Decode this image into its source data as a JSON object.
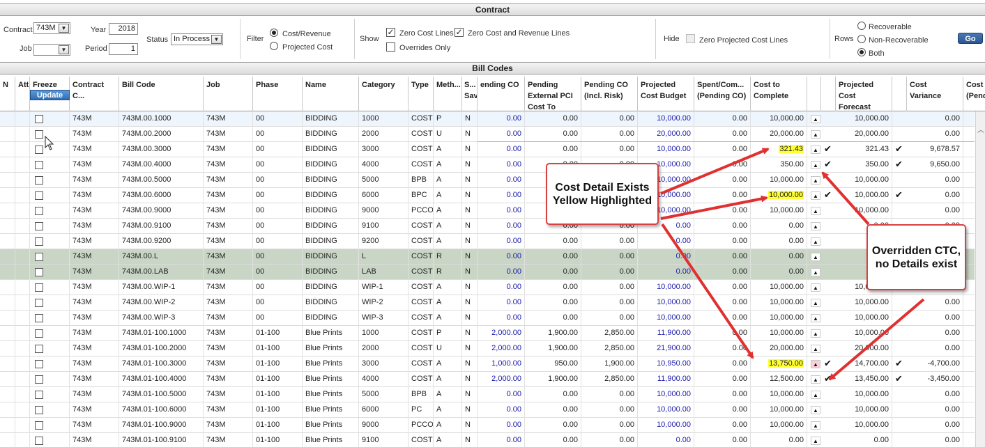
{
  "contract_section": {
    "title": "Contract",
    "contract_label": "Contract",
    "contract_value": "743M",
    "job_label": "Job",
    "job_value": "",
    "year_label": "Year",
    "year_value": "2018",
    "period_label": "Period",
    "period_value": "1",
    "status_label": "Status",
    "status_value": "In Process",
    "filter_label": "Filter",
    "filter_options": [
      "Cost/Revenue",
      "Projected Cost"
    ],
    "filter_selected": "Cost/Revenue",
    "show_label": "Show",
    "show_zero_cost_lines": "Zero Cost Lines",
    "show_zero_cost_revenue_lines": "Zero Cost and Revenue Lines",
    "show_overrides_only": "Overrides Only",
    "hide_label": "Hide",
    "hide_zero_projected": "Zero Projected Cost Lines",
    "rows_label": "Rows",
    "rows_options": [
      "Recoverable",
      "Non-Recoverable",
      "Both"
    ],
    "rows_selected": "Both",
    "go_label": "Go"
  },
  "bill_codes": {
    "title": "Bill Codes",
    "update_label": "Update",
    "headers": {
      "n": "N",
      "att": "Att",
      "freeze": "Freeze",
      "contract_c": "Contract C...",
      "bill_code": "Bill Code",
      "job": "Job",
      "phase": "Phase",
      "name": "Name",
      "category": "Category",
      "type": "Type",
      "meth": "Meth...",
      "s": "S...\nSav",
      "pending_co": "ending CO",
      "pending_ext": "Pending\nExternal PCI\nCost To Comple",
      "pending_co_risk": "Pending CO\n(Incl. Risk)",
      "projected_cost_budget": "Projected\nCost Budget",
      "spent_com": "Spent/Com...\n(Pending CO)",
      "cost_to_complete": "Cost to\nComplete",
      "projected_cost_forecast": "Projected\nCost Forecast",
      "cost_variance": "Cost\nVariance",
      "cost_pend": "Cost\n(Pend"
    },
    "rows": [
      {
        "contract": "743M",
        "bill": "743M.00.1000",
        "job": "743M",
        "phase": "00",
        "name": "BIDDING",
        "cat": "1000",
        "type": "COST",
        "meth": "P",
        "s": "N",
        "pco": "0.00",
        "pext": "0.00",
        "prisk": "0.00",
        "pcb": "10,000.00",
        "spent": "0.00",
        "ctc": "10,000.00",
        "ctc_hl": false,
        "ctc_chk": false,
        "pcf": "10,000.00",
        "pcf_chk": false,
        "var": "0.00",
        "tri_pink": false,
        "style": "sel"
      },
      {
        "contract": "743M",
        "bill": "743M.00.2000",
        "job": "743M",
        "phase": "00",
        "name": "BIDDING",
        "cat": "2000",
        "type": "COST",
        "meth": "U",
        "s": "N",
        "pco": "0.00",
        "pext": "0.00",
        "prisk": "0.00",
        "pcb": "20,000.00",
        "spent": "0.00",
        "ctc": "20,000.00",
        "ctc_hl": false,
        "ctc_chk": false,
        "pcf": "20,000.00",
        "pcf_chk": false,
        "var": "0.00",
        "tri_pink": false,
        "style": ""
      },
      {
        "contract": "743M",
        "bill": "743M.00.3000",
        "job": "743M",
        "phase": "00",
        "name": "BIDDING",
        "cat": "3000",
        "type": "COST",
        "meth": "A",
        "s": "N",
        "pco": "0.00",
        "pext": "0.00",
        "prisk": "0.00",
        "pcb": "10,000.00",
        "spent": "0.00",
        "ctc": "321.43",
        "ctc_hl": true,
        "ctc_chk": true,
        "pcf": "321.43",
        "pcf_chk": true,
        "var": "9,678.57",
        "tri_pink": false,
        "style": ""
      },
      {
        "contract": "743M",
        "bill": "743M.00.4000",
        "job": "743M",
        "phase": "00",
        "name": "BIDDING",
        "cat": "4000",
        "type": "COST",
        "meth": "A",
        "s": "N",
        "pco": "0.00",
        "pext": "0.00",
        "prisk": "0.00",
        "pcb": "10,000.00",
        "spent": "0.00",
        "ctc": "350.00",
        "ctc_hl": false,
        "ctc_chk": true,
        "pcf": "350.00",
        "pcf_chk": true,
        "var": "9,650.00",
        "tri_pink": false,
        "style": ""
      },
      {
        "contract": "743M",
        "bill": "743M.00.5000",
        "job": "743M",
        "phase": "00",
        "name": "BIDDING",
        "cat": "5000",
        "type": "BPB",
        "meth": "A",
        "s": "N",
        "pco": "0.00",
        "pext": "0.00",
        "prisk": "0.00",
        "pcb": "10,000.00",
        "spent": "0.00",
        "ctc": "10,000.00",
        "ctc_hl": false,
        "ctc_chk": false,
        "pcf": "10,000.00",
        "pcf_chk": false,
        "var": "0.00",
        "tri_pink": false,
        "style": ""
      },
      {
        "contract": "743M",
        "bill": "743M.00.6000",
        "job": "743M",
        "phase": "00",
        "name": "BIDDING",
        "cat": "6000",
        "type": "BPC",
        "meth": "A",
        "s": "N",
        "pco": "0.00",
        "pext": "0.00",
        "prisk": "0.00",
        "pcb": "10,000.00",
        "spent": "0.00",
        "ctc": "10,000.00",
        "ctc_hl": true,
        "ctc_chk": true,
        "pcf": "10,000.00",
        "pcf_chk": true,
        "var": "0.00",
        "tri_pink": false,
        "style": ""
      },
      {
        "contract": "743M",
        "bill": "743M.00.9000",
        "job": "743M",
        "phase": "00",
        "name": "BIDDING",
        "cat": "9000",
        "type": "PCCO",
        "meth": "A",
        "s": "N",
        "pco": "0.00",
        "pext": "0.00",
        "prisk": "0.00",
        "pcb": "10,000.00",
        "spent": "0.00",
        "ctc": "10,000.00",
        "ctc_hl": false,
        "ctc_chk": false,
        "pcf": "10,000.00",
        "pcf_chk": false,
        "var": "0.00",
        "tri_pink": false,
        "style": ""
      },
      {
        "contract": "743M",
        "bill": "743M.00.9100",
        "job": "743M",
        "phase": "00",
        "name": "BIDDING",
        "cat": "9100",
        "type": "COST",
        "meth": "A",
        "s": "N",
        "pco": "0.00",
        "pext": "0.00",
        "prisk": "0.00",
        "pcb": "0.00",
        "spent": "0.00",
        "ctc": "0.00",
        "ctc_hl": false,
        "ctc_chk": false,
        "pcf": "0.00",
        "pcf_chk": false,
        "var": "0.00",
        "tri_pink": false,
        "style": ""
      },
      {
        "contract": "743M",
        "bill": "743M.00.9200",
        "job": "743M",
        "phase": "00",
        "name": "BIDDING",
        "cat": "9200",
        "type": "COST",
        "meth": "A",
        "s": "N",
        "pco": "0.00",
        "pext": "0.00",
        "prisk": "0.00",
        "pcb": "0.00",
        "spent": "0.00",
        "ctc": "0.00",
        "ctc_hl": false,
        "ctc_chk": false,
        "pcf": "0.00",
        "pcf_chk": false,
        "var": "0.00",
        "tri_pink": false,
        "style": ""
      },
      {
        "contract": "743M",
        "bill": "743M.00.L",
        "job": "743M",
        "phase": "00",
        "name": "BIDDING",
        "cat": "L",
        "type": "COST",
        "meth": "R",
        "s": "N",
        "pco": "0.00",
        "pext": "0.00",
        "prisk": "0.00",
        "pcb": "0.00",
        "spent": "0.00",
        "ctc": "0.00",
        "ctc_hl": false,
        "ctc_chk": false,
        "pcf": "",
        "pcf_chk": false,
        "var": "0.00",
        "tri_pink": false,
        "style": "grn"
      },
      {
        "contract": "743M",
        "bill": "743M.00.LAB",
        "job": "743M",
        "phase": "00",
        "name": "BIDDING",
        "cat": "LAB",
        "type": "COST",
        "meth": "R",
        "s": "N",
        "pco": "0.00",
        "pext": "0.00",
        "prisk": "0.00",
        "pcb": "0.00",
        "spent": "0.00",
        "ctc": "0.00",
        "ctc_hl": false,
        "ctc_chk": false,
        "pcf": "",
        "pcf_chk": false,
        "var": "0.00",
        "tri_pink": false,
        "style": "grn"
      },
      {
        "contract": "743M",
        "bill": "743M.00.WIP-1",
        "job": "743M",
        "phase": "00",
        "name": "BIDDING",
        "cat": "WIP-1",
        "type": "COST",
        "meth": "A",
        "s": "N",
        "pco": "0.00",
        "pext": "0.00",
        "prisk": "0.00",
        "pcb": "10,000.00",
        "spent": "0.00",
        "ctc": "10,000.00",
        "ctc_hl": false,
        "ctc_chk": false,
        "pcf": "10,000.00",
        "pcf_chk": false,
        "var": "0.00",
        "tri_pink": false,
        "style": ""
      },
      {
        "contract": "743M",
        "bill": "743M.00.WIP-2",
        "job": "743M",
        "phase": "00",
        "name": "BIDDING",
        "cat": "WIP-2",
        "type": "COST",
        "meth": "A",
        "s": "N",
        "pco": "0.00",
        "pext": "0.00",
        "prisk": "0.00",
        "pcb": "10,000.00",
        "spent": "0.00",
        "ctc": "10,000.00",
        "ctc_hl": false,
        "ctc_chk": false,
        "pcf": "10,000.00",
        "pcf_chk": false,
        "var": "0.00",
        "tri_pink": false,
        "style": ""
      },
      {
        "contract": "743M",
        "bill": "743M.00.WIP-3",
        "job": "743M",
        "phase": "00",
        "name": "BIDDING",
        "cat": "WIP-3",
        "type": "COST",
        "meth": "A",
        "s": "N",
        "pco": "0.00",
        "pext": "0.00",
        "prisk": "0.00",
        "pcb": "10,000.00",
        "spent": "0.00",
        "ctc": "10,000.00",
        "ctc_hl": false,
        "ctc_chk": false,
        "pcf": "10,000.00",
        "pcf_chk": false,
        "var": "0.00",
        "tri_pink": false,
        "style": ""
      },
      {
        "contract": "743M",
        "bill": "743M.01-100.1000",
        "job": "743M",
        "phase": "01-100",
        "name": "Blue Prints",
        "cat": "1000",
        "type": "COST",
        "meth": "P",
        "s": "N",
        "pco": "2,000.00",
        "pext": "1,900.00",
        "prisk": "2,850.00",
        "pcb": "11,900.00",
        "spent": "0.00",
        "ctc": "10,000.00",
        "ctc_hl": false,
        "ctc_chk": false,
        "pcf": "10,000.00",
        "pcf_chk": false,
        "var": "0.00",
        "tri_pink": false,
        "style": ""
      },
      {
        "contract": "743M",
        "bill": "743M.01-100.2000",
        "job": "743M",
        "phase": "01-100",
        "name": "Blue Prints",
        "cat": "2000",
        "type": "COST",
        "meth": "U",
        "s": "N",
        "pco": "2,000.00",
        "pext": "1,900.00",
        "prisk": "2,850.00",
        "pcb": "21,900.00",
        "spent": "0.00",
        "ctc": "20,000.00",
        "ctc_hl": false,
        "ctc_chk": false,
        "pcf": "20,000.00",
        "pcf_chk": false,
        "var": "0.00",
        "tri_pink": false,
        "style": ""
      },
      {
        "contract": "743M",
        "bill": "743M.01-100.3000",
        "job": "743M",
        "phase": "01-100",
        "name": "Blue Prints",
        "cat": "3000",
        "type": "COST",
        "meth": "A",
        "s": "N",
        "pco": "1,000.00",
        "pext": "950.00",
        "prisk": "1,900.00",
        "pcb": "10,950.00",
        "spent": "0.00",
        "ctc": "13,750.00",
        "ctc_hl": true,
        "ctc_chk": true,
        "pcf": "14,700.00",
        "pcf_chk": true,
        "var": "-4,700.00",
        "tri_pink": true,
        "style": ""
      },
      {
        "contract": "743M",
        "bill": "743M.01-100.4000",
        "job": "743M",
        "phase": "01-100",
        "name": "Blue Prints",
        "cat": "4000",
        "type": "COST",
        "meth": "A",
        "s": "N",
        "pco": "2,000.00",
        "pext": "1,900.00",
        "prisk": "2,850.00",
        "pcb": "11,900.00",
        "spent": "0.00",
        "ctc": "12,500.00",
        "ctc_hl": false,
        "ctc_chk": true,
        "pcf": "13,450.00",
        "pcf_chk": true,
        "var": "-3,450.00",
        "tri_pink": false,
        "style": ""
      },
      {
        "contract": "743M",
        "bill": "743M.01-100.5000",
        "job": "743M",
        "phase": "01-100",
        "name": "Blue Prints",
        "cat": "5000",
        "type": "BPB",
        "meth": "A",
        "s": "N",
        "pco": "0.00",
        "pext": "0.00",
        "prisk": "0.00",
        "pcb": "10,000.00",
        "spent": "0.00",
        "ctc": "10,000.00",
        "ctc_hl": false,
        "ctc_chk": false,
        "pcf": "10,000.00",
        "pcf_chk": false,
        "var": "0.00",
        "tri_pink": false,
        "style": ""
      },
      {
        "contract": "743M",
        "bill": "743M.01-100.6000",
        "job": "743M",
        "phase": "01-100",
        "name": "Blue Prints",
        "cat": "6000",
        "type": "PC",
        "meth": "A",
        "s": "N",
        "pco": "0.00",
        "pext": "0.00",
        "prisk": "0.00",
        "pcb": "10,000.00",
        "spent": "0.00",
        "ctc": "10,000.00",
        "ctc_hl": false,
        "ctc_chk": false,
        "pcf": "10,000.00",
        "pcf_chk": false,
        "var": "0.00",
        "tri_pink": false,
        "style": ""
      },
      {
        "contract": "743M",
        "bill": "743M.01-100.9000",
        "job": "743M",
        "phase": "01-100",
        "name": "Blue Prints",
        "cat": "9000",
        "type": "PCCO",
        "meth": "A",
        "s": "N",
        "pco": "0.00",
        "pext": "0.00",
        "prisk": "0.00",
        "pcb": "10,000.00",
        "spent": "0.00",
        "ctc": "10,000.00",
        "ctc_hl": false,
        "ctc_chk": false,
        "pcf": "10,000.00",
        "pcf_chk": false,
        "var": "0.00",
        "tri_pink": false,
        "style": ""
      },
      {
        "contract": "743M",
        "bill": "743M.01-100.9100",
        "job": "743M",
        "phase": "01-100",
        "name": "Blue Prints",
        "cat": "9100",
        "type": "COST",
        "meth": "A",
        "s": "N",
        "pco": "0.00",
        "pext": "0.00",
        "prisk": "0.00",
        "pcb": "0.00",
        "spent": "0.00",
        "ctc": "0.00",
        "ctc_hl": false,
        "ctc_chk": false,
        "pcf": "0.00",
        "pcf_chk": false,
        "var": "0.00",
        "tri_pink": false,
        "style": ""
      }
    ]
  },
  "annotations": {
    "callout_cost_detail": "Cost Detail Exists\nYellow Highlighted",
    "callout_overridden": "Overridden CTC,\nno Details exist",
    "arrow_color": "#e03030"
  },
  "colors": {
    "highlight_yellow": "#ffff33",
    "green_row": "#c9d5c5",
    "blue_text": "#1a1aa8",
    "go_button": "#2b5690"
  }
}
